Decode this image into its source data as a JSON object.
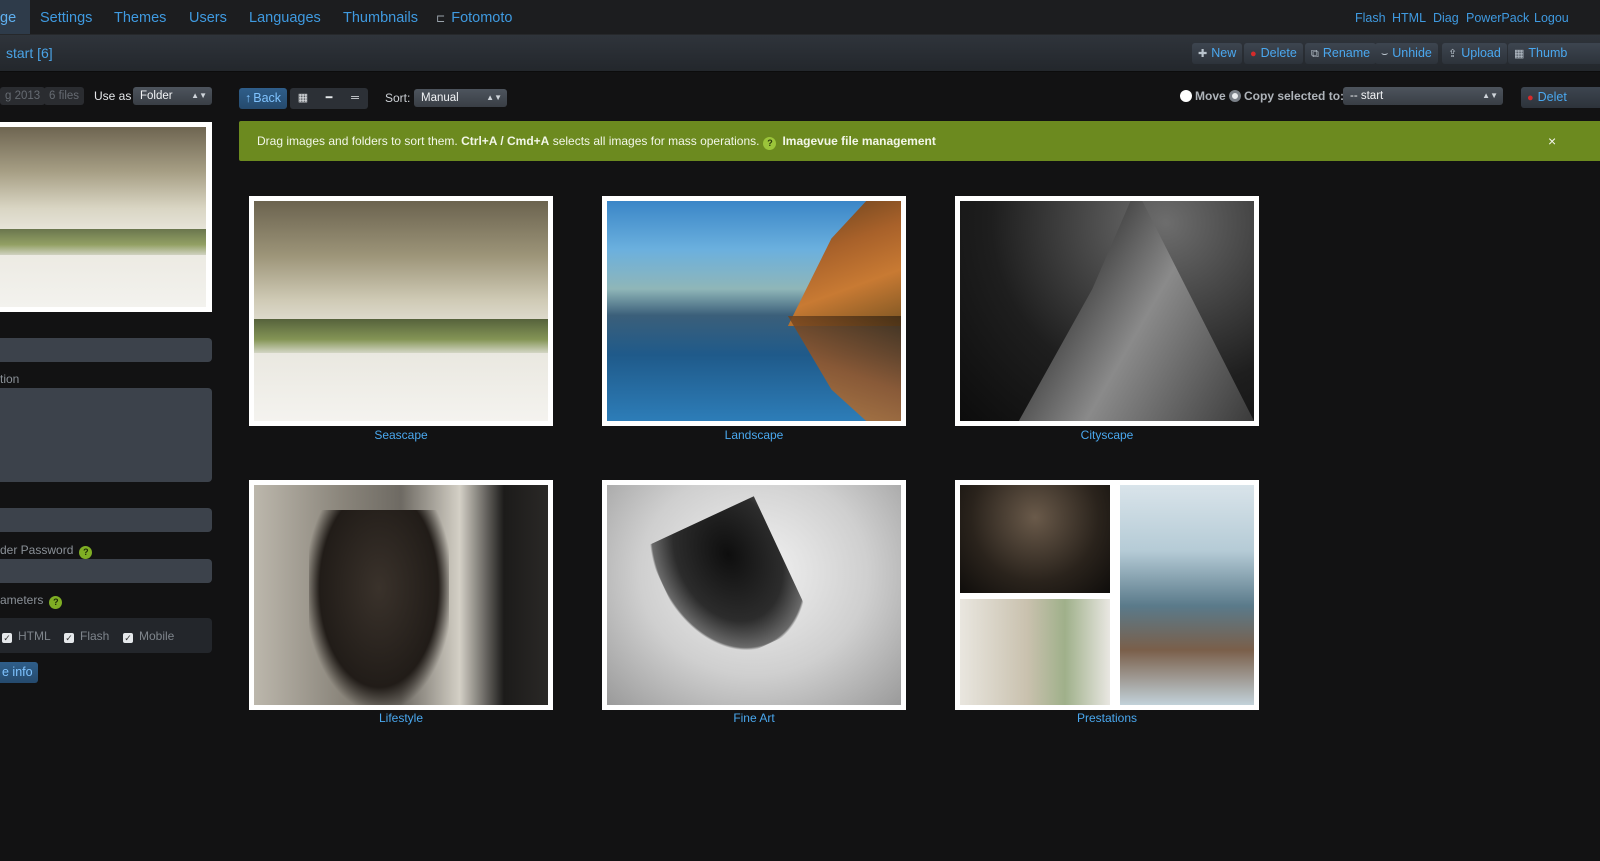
{
  "nav": {
    "tabs": [
      {
        "label": "ge"
      },
      {
        "label": "Settings"
      },
      {
        "label": "Themes"
      },
      {
        "label": "Users"
      },
      {
        "label": "Languages"
      },
      {
        "label": "Thumbnails"
      },
      {
        "label": "Fotomoto"
      }
    ],
    "right_links": [
      "Flash",
      "HTML",
      "Diag",
      "PowerPack",
      "Logou"
    ]
  },
  "toolbar": {
    "breadcrumb": "start [6]",
    "new_label": "New",
    "delete_label": "Delete",
    "rename_label": "Rename",
    "unhide_label": "Unhide",
    "upload_label": "Upload",
    "thumbs_label": "Thumb"
  },
  "sidebar": {
    "date_pill": "g 2013",
    "files_pill": "6 files",
    "use_as_label": "Use as",
    "use_as_value": "Folder",
    "description_label": "tion",
    "password_label": "der Password",
    "params_label": "ameters",
    "checks": [
      "HTML",
      "Flash",
      "Mobile"
    ],
    "more_info_label": "e info"
  },
  "controls": {
    "back_label": "Back",
    "sort_label": "Sort:",
    "sort_value": "Manual",
    "move_label": "Move",
    "copy_label": "Copy selected to:",
    "target_value": "-- start",
    "delete_label": "Delet"
  },
  "notice": {
    "text_a": "Drag images and folders to sort them.",
    "text_b": "Ctrl+A / Cmd+A",
    "text_c": "selects all images for mass operations.",
    "q": "?",
    "link": "Imagevue file management",
    "close": "×"
  },
  "folders": [
    {
      "label": "Seascape"
    },
    {
      "label": "Landscape"
    },
    {
      "label": "Cityscape"
    },
    {
      "label": "Lifestyle"
    },
    {
      "label": "Fine Art"
    },
    {
      "label": "Prestations"
    }
  ],
  "colors": {
    "accent": "#3f9ae0",
    "notice_bg": "#6c8a1f",
    "danger": "#d42b2b"
  }
}
